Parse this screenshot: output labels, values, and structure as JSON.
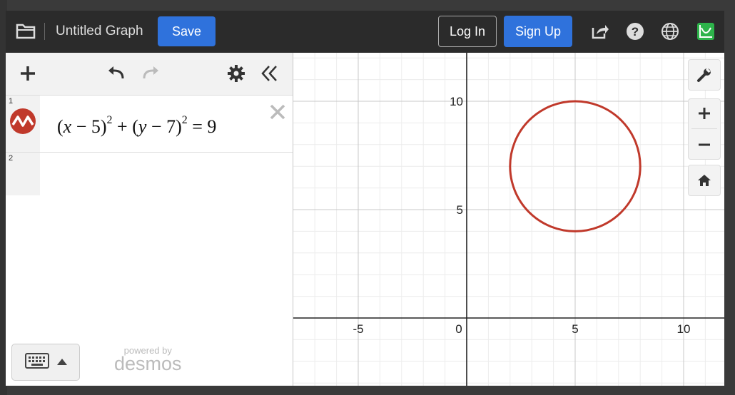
{
  "header": {
    "title": "Untitled Graph",
    "save_label": "Save",
    "login_label": "Log In",
    "signup_label": "Sign Up"
  },
  "expressions": [
    {
      "num": "1",
      "color": "#c0392b"
    },
    {
      "num": "2"
    }
  ],
  "branding": {
    "small": "powered by",
    "big": "desmos"
  },
  "axes": {
    "x_ticks": [
      "-5",
      "0",
      "5",
      "10"
    ],
    "y_ticks": [
      "5",
      "10"
    ],
    "x_range": [
      -8,
      11.5
    ],
    "y_range": [
      -3,
      12
    ]
  },
  "curve": {
    "type": "circle",
    "h": 5,
    "k": 7,
    "r": 3,
    "color": "#c0392b"
  },
  "colors": {
    "accent": "#2f72dc",
    "topbar": "#2b2b2b"
  }
}
